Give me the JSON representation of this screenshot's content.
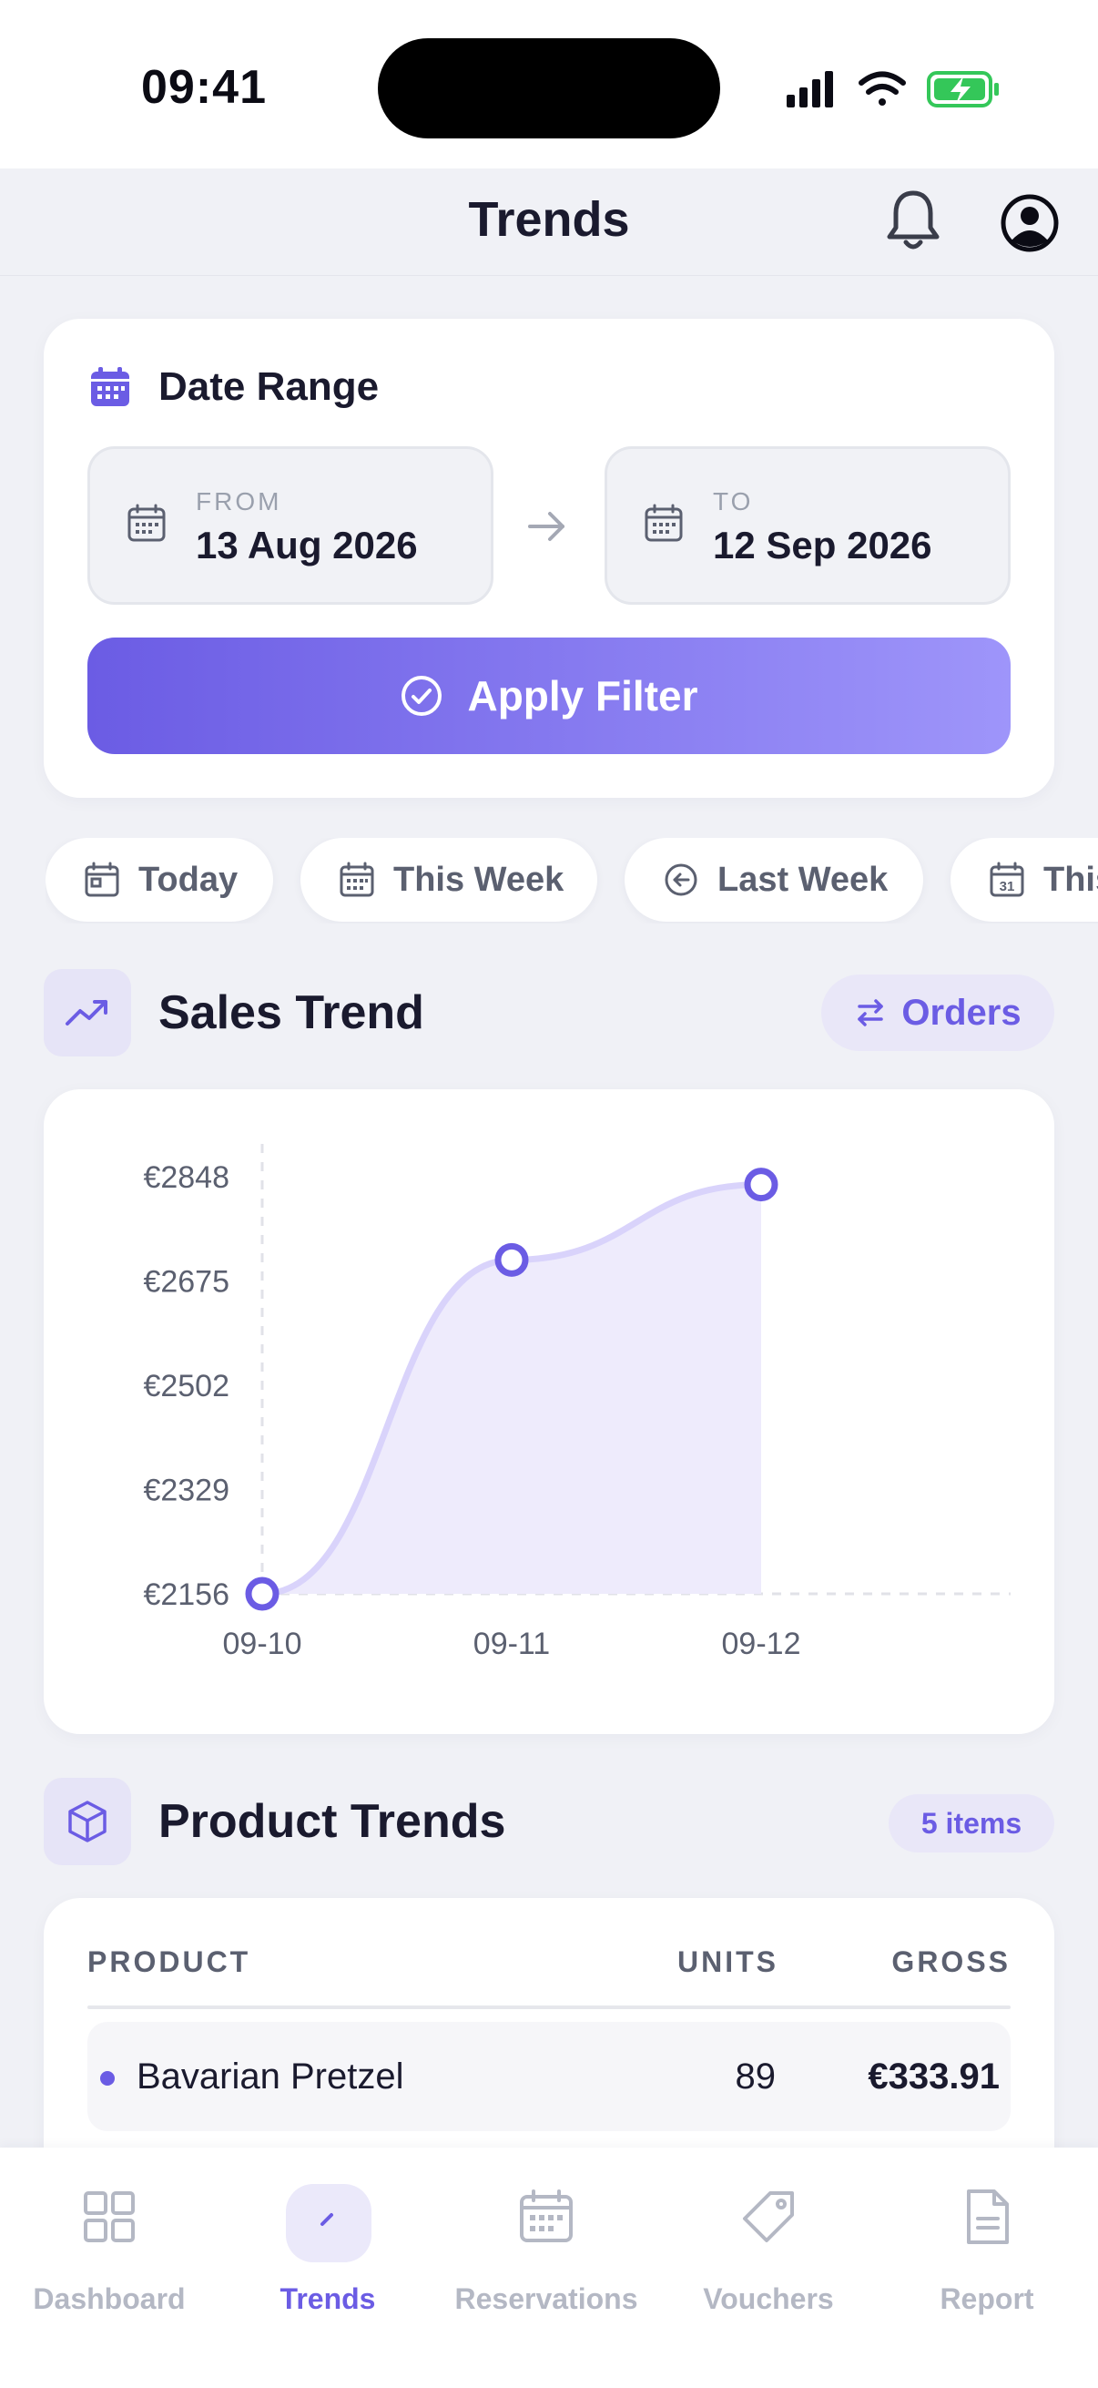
{
  "status_bar": {
    "time": "09:41"
  },
  "header": {
    "title": "Trends",
    "bell_icon": "bell-icon",
    "avatar_icon": "user-circle-icon"
  },
  "date_range": {
    "title": "Date Range",
    "from_label": "FROM",
    "from_value": "13 Aug 2026",
    "to_label": "TO",
    "to_value": "12 Sep 2026",
    "apply_label": "Apply Filter"
  },
  "quick_filters": [
    {
      "label": "Today",
      "icon": "calendar-day-icon"
    },
    {
      "label": "This Week",
      "icon": "calendar-grid-icon"
    },
    {
      "label": "Last Week",
      "icon": "arrow-left-circle-icon"
    },
    {
      "label": "This Month",
      "icon": "calendar-31-icon"
    }
  ],
  "sales_trend": {
    "title": "Sales Trend",
    "toggle_label": "Orders"
  },
  "chart_data": {
    "type": "area",
    "x": [
      "09-10",
      "09-11",
      "09-12"
    ],
    "values": [
      2156,
      2710,
      2835
    ],
    "y_ticks": [
      "€2848",
      "€2675",
      "€2502",
      "€2329",
      "€2156"
    ],
    "ylim": [
      2156,
      2848
    ],
    "grid": false,
    "accent": "#6b5ce4"
  },
  "product_trends": {
    "title": "Product Trends",
    "badge": "5 items",
    "columns": [
      "PRODUCT",
      "UNITS",
      "GROSS"
    ],
    "rows": [
      {
        "name": "Bavarian Pretzel",
        "units": "89",
        "gross": "€333.91"
      }
    ]
  },
  "bottom_nav": [
    {
      "label": "Dashboard",
      "icon": "grid-icon",
      "active": false
    },
    {
      "label": "Trends",
      "icon": "pen-icon",
      "active": true
    },
    {
      "label": "Reservations",
      "icon": "calendar-icon",
      "active": false
    },
    {
      "label": "Vouchers",
      "icon": "tag-icon",
      "active": false
    },
    {
      "label": "Report",
      "icon": "document-icon",
      "active": false
    }
  ],
  "colors": {
    "accent": "#6b5ce4",
    "accent_light": "#9e95fa",
    "background": "#f0f1f6"
  }
}
